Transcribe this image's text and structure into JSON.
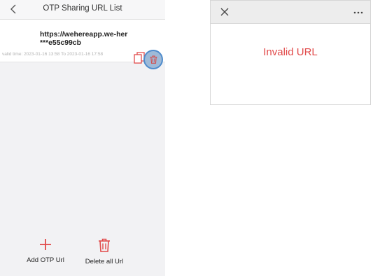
{
  "app": {
    "title": "OTP Sharing URL List"
  },
  "url_list": [
    {
      "url_line1": "https://wehereapp.we-her",
      "url_line2": "***e55c99cb",
      "valid_time": "valid time: 2023-01-16 13:58 To 2023-01-16 17:58"
    }
  ],
  "actions": {
    "add_label": "Add OTP Url",
    "delete_all_label": "Delete all Url"
  },
  "browser": {
    "message": "Invalid URL"
  },
  "colors": {
    "accent_red": "#e14a4a",
    "highlight_blue": "#4f8ccc",
    "highlight_fill": "#9ebad8"
  },
  "icons": [
    "back-icon",
    "copy-icon",
    "trash-icon",
    "plus-icon",
    "close-icon",
    "more-icon"
  ]
}
